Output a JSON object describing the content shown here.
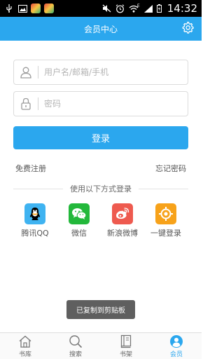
{
  "status_bar": {
    "time": "14:32",
    "network_type": "E"
  },
  "header": {
    "title": "会员中心"
  },
  "login_form": {
    "username_placeholder": "用户名/邮箱/手机",
    "password_placeholder": "密码",
    "login_label": "登录"
  },
  "links": {
    "register": "免费注册",
    "forgot_password": "忘记密码"
  },
  "social_login": {
    "heading": "使用以下方式登录",
    "options": [
      {
        "label": "腾讯QQ",
        "icon": "qq-icon",
        "color": "#3fb3f1"
      },
      {
        "label": "微信",
        "icon": "wechat-icon",
        "color": "#23b83b"
      },
      {
        "label": "新浪微博",
        "icon": "weibo-icon",
        "color": "#ee5a4f"
      },
      {
        "label": "一键登录",
        "icon": "one-click-login-icon",
        "color": "#f7a21a"
      }
    ]
  },
  "toast": {
    "message": "已复制到剪贴板"
  },
  "bottom_nav": {
    "items": [
      {
        "label": "书库",
        "icon": "home-icon",
        "active": false
      },
      {
        "label": "搜索",
        "icon": "search-icon",
        "active": false
      },
      {
        "label": "书架",
        "icon": "bookshelf-icon",
        "active": false
      },
      {
        "label": "会员",
        "icon": "member-icon",
        "active": true
      }
    ]
  },
  "colors": {
    "accent": "#2ba7ee"
  }
}
